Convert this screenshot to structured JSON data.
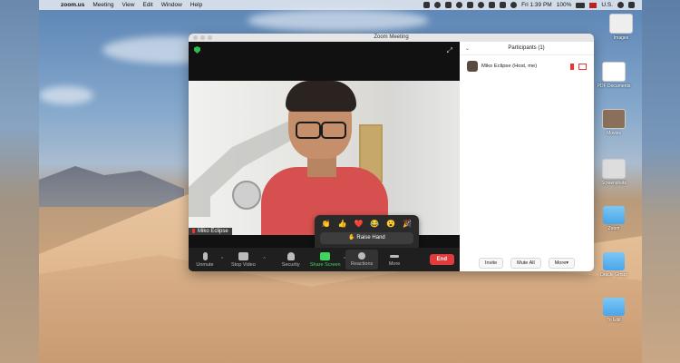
{
  "menubar": {
    "app": "zoom.us",
    "items": [
      "Meeting",
      "View",
      "Edit",
      "Window",
      "Help"
    ],
    "battery": "100%",
    "time": "Fri 1:39 PM",
    "region": "U.S."
  },
  "window": {
    "title": "Zoom Meeting"
  },
  "video": {
    "participant_name": "Miko Eclipse"
  },
  "reactions": {
    "emojis": [
      "👏",
      "👍",
      "❤️",
      "😂",
      "😮",
      "🎉"
    ],
    "raise_hand": "✋ Raise Hand"
  },
  "toolbar": {
    "unmute": "Unmute",
    "stop_video": "Stop Video",
    "security": "Security",
    "share_screen": "Share Screen",
    "reactions": "Reactions",
    "more": "More",
    "end": "End"
  },
  "participants": {
    "title": "Participants (1)",
    "list": [
      {
        "name": "Miko Eclipse (Host, me)"
      }
    ],
    "invite": "Invite",
    "mute_all": "Mute All",
    "more": "More▾"
  },
  "desktop_icons": [
    {
      "label": "Images",
      "icon": "image-file-icon"
    },
    {
      "label": "PDF Documents",
      "icon": "pdf-file-icon"
    },
    {
      "label": "Movies",
      "icon": "image-file-icon"
    },
    {
      "label": "Screenshots",
      "icon": "image-file-icon"
    },
    {
      "label": "Zoom",
      "icon": "folder-icon"
    },
    {
      "label": "Oracle Group",
      "icon": "folder-icon"
    },
    {
      "label": "To Edit",
      "icon": "folder-icon"
    }
  ],
  "colors": {
    "end_button": "#e23b3b",
    "share_green": "#3fd75b",
    "folder_blue": "#4aa6e8"
  }
}
